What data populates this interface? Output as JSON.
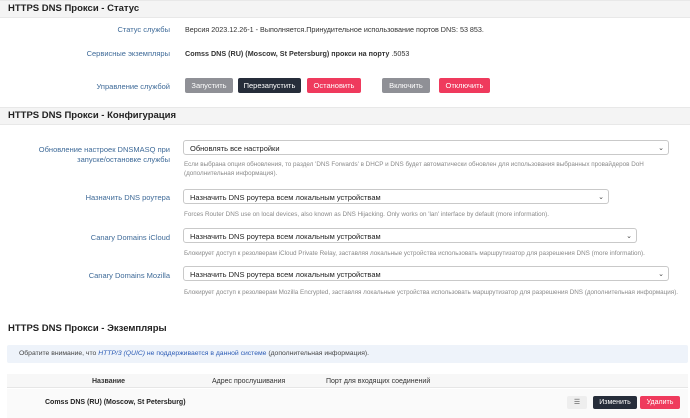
{
  "status": {
    "title": "HTTPS DNS Прокси - Статус",
    "rows": {
      "service_status_label": "Статус службы",
      "service_status_value": "Версия 2023.12.26-1 - Выполняется.Принудительное использование портов DNS: 53 853.",
      "instances_label": "Сервисные экземпляры",
      "instances_value_bold": "Comss DNS (RU) (Moscow, St Petersburg) прокси на порту",
      "instances_value_port": ".5053",
      "control_label": "Управление службой"
    },
    "buttons": {
      "start": "Запустить",
      "restart": "Перезапустить",
      "stop": "Остановить",
      "enable": "Включить",
      "disable": "Отключить"
    }
  },
  "config": {
    "title": "HTTPS DNS Прокси - Конфигурация",
    "dnsmasq": {
      "label_line1": "Обновление настроек DNSMASQ при",
      "label_line2": "запуске/остановке службы",
      "value": "Обновлять все настройки",
      "help_line1": "Если выбрана опция обновления, то раздел 'DNS Forwards' в DHCP и DNS будет автоматически обновлен для использования выбранных провайдеров DoH",
      "help_line2": "(дополнительная информация)."
    },
    "router_dns": {
      "label": "Назначить DNS роутера",
      "value": "Назначить DNS роутера всем локальным устройствам",
      "help": "Forces Router DNS use on local devices, also known as DNS Hijacking. Only works on 'lan' interface by default (more information)."
    },
    "icloud": {
      "label": "Canary Domains iCloud",
      "value": "Назначить DNS роутера всем локальным устройствам",
      "help": "Блокирует доступ к резолверам iCloud Private Relay, заставляя локальные устройства использовать маршрутизатор для разрешения DNS (more information)."
    },
    "mozilla": {
      "label": "Canary Domains Mozilla",
      "value": "Назначить DNS роутера всем локальным устройствам",
      "help": "Блокирует доступ к резолверам Mozilla Encrypted, заставляя локальные устройства использовать маршрутизатор для разрешения DNS (дополнительная информация)."
    }
  },
  "instances": {
    "title": "HTTPS DNS Прокси - Экземпляры",
    "notice_part1": "Обратите внимание, что ",
    "notice_part2": "HTTP/3 (QUIC)",
    "notice_part3": " не поддерживается в данной системе",
    "notice_part4": " (дополнительная информация).",
    "columns": {
      "name": "Название",
      "listen": "Адрес прослушивания",
      "port": "Порт для входящих соединений"
    },
    "rows": [
      {
        "name": "Comss DNS (RU) (Moscow, St Petersburg)",
        "drag": "☰",
        "edit": "Изменить",
        "delete": "Удалить"
      }
    ]
  }
}
